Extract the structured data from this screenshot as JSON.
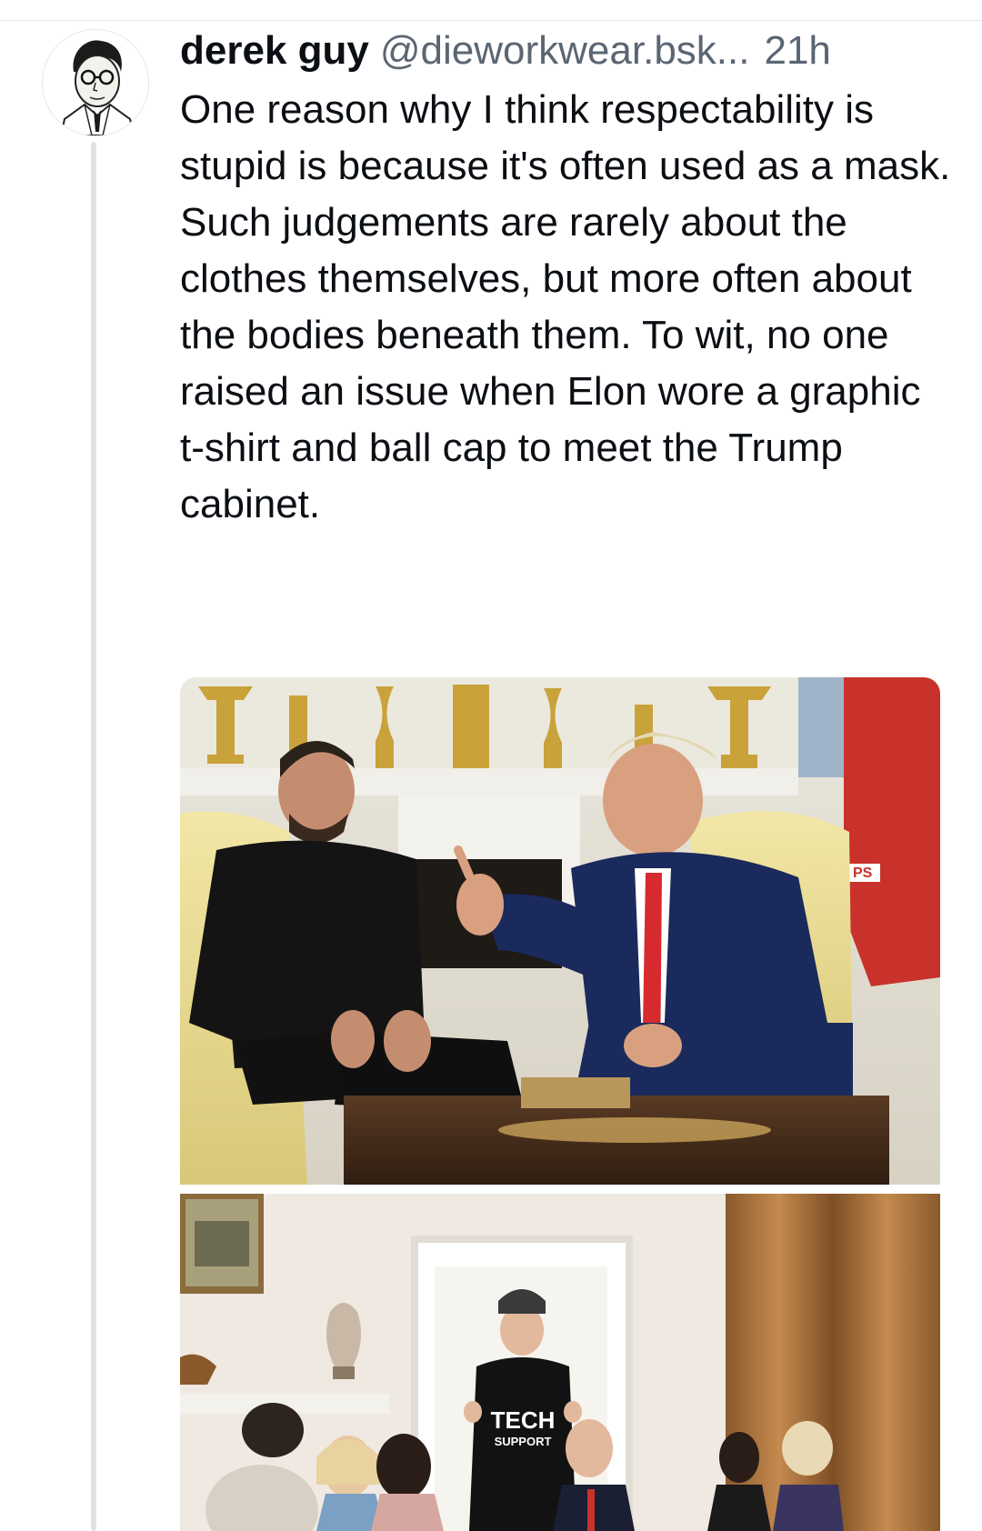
{
  "post": {
    "display_name": "derek guy",
    "handle": "@dieworkwear.bsk...",
    "time": "21h",
    "text": "One reason why I think respectability is stupid is because it's often used as a mask. Such judgements are rarely about the clothes themselves, but more often about the bodies beneath them. To wit, no one raised an issue when Elon wore a graphic t-shirt and ball cap to meet the Trump cabinet."
  },
  "media": {
    "image2_shirt_line1": "TECH",
    "image2_shirt_line2": "SUPPORT",
    "image1_flag_text": "PS"
  },
  "colors": {
    "handle_gray": "#5b6673",
    "thread_line": "#dfe3e8"
  }
}
